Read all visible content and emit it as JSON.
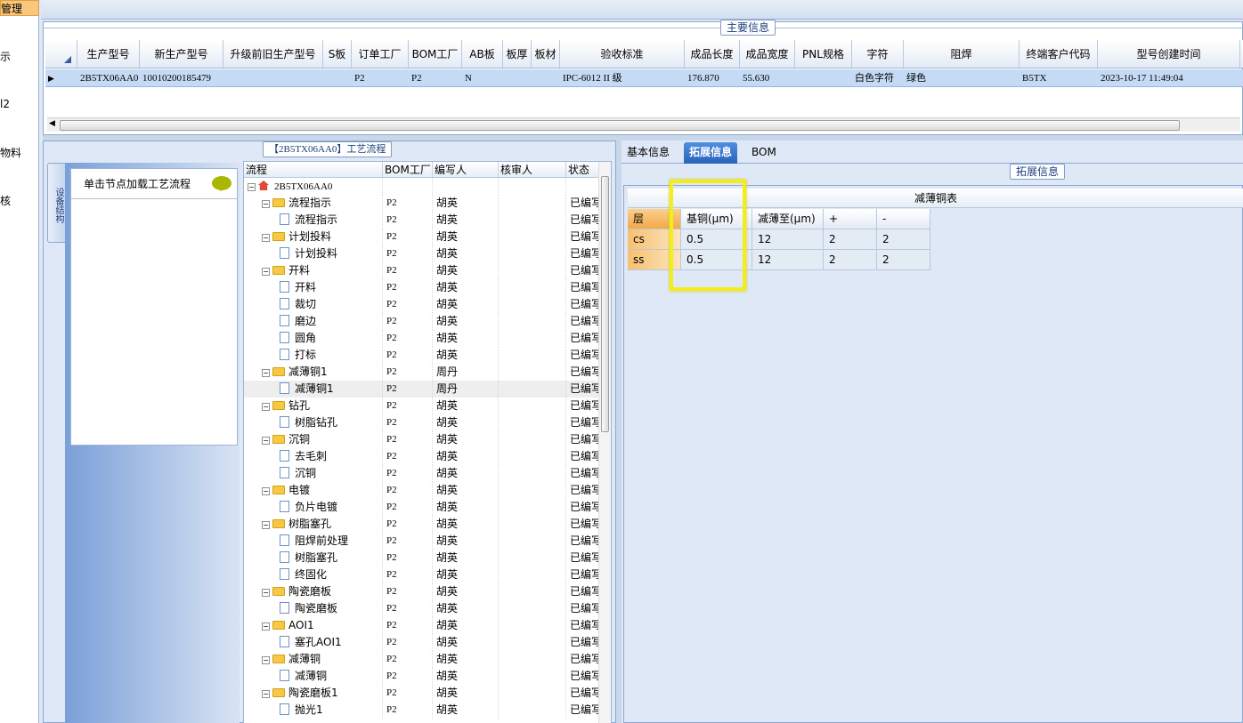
{
  "left_nav": {
    "items": [
      {
        "label": "管理",
        "active": true
      },
      {
        "label": "示"
      },
      {
        "label": "l2"
      },
      {
        "label": "物料"
      },
      {
        "label": "核"
      }
    ]
  },
  "top_strip": {
    "text": "·······"
  },
  "main_info": {
    "title": "主要信息",
    "columns": [
      "生产型号",
      "新生产型号",
      "升级前旧生产型号",
      "S板",
      "订单工厂",
      "BOM工厂",
      "AB板",
      "板厚",
      "板材",
      "验收标准",
      "成品长度",
      "成品宽度",
      "PNL规格",
      "字符",
      "阻焊",
      "终端客户代码",
      "型号创建时间"
    ],
    "row": [
      "2B5TX06AA0",
      "10010200185479",
      "",
      "",
      "P2",
      "P2",
      "N",
      "",
      "",
      "IPC-6012 II 级",
      "176.870",
      "55.630",
      "",
      "白色字符",
      "绿色",
      "B5TX",
      "2023-10-17 11:49:04"
    ]
  },
  "flow_panel": {
    "title": "【2B5TX06AA0】工艺流程",
    "vertical_tab": "设备结构",
    "hint": "单击节点加载工艺流程",
    "tree_columns": [
      "流程",
      "BOM工厂",
      "编写人",
      "核审人",
      "状态"
    ],
    "rows": [
      {
        "level": 0,
        "type": "root",
        "name": "2B5TX06AA0",
        "bom": "",
        "author": "",
        "reviewer": "",
        "status": ""
      },
      {
        "level": 1,
        "type": "folder",
        "name": "流程指示",
        "bom": "P2",
        "author": "胡英",
        "reviewer": "",
        "status": "已编写"
      },
      {
        "level": 2,
        "type": "file",
        "name": "流程指示",
        "bom": "P2",
        "author": "胡英",
        "reviewer": "",
        "status": "已编写"
      },
      {
        "level": 1,
        "type": "folder",
        "name": "计划投料",
        "bom": "P2",
        "author": "胡英",
        "reviewer": "",
        "status": "已编写"
      },
      {
        "level": 2,
        "type": "file",
        "name": "计划投料",
        "bom": "P2",
        "author": "胡英",
        "reviewer": "",
        "status": "已编写"
      },
      {
        "level": 1,
        "type": "folder",
        "name": "开料",
        "bom": "P2",
        "author": "胡英",
        "reviewer": "",
        "status": "已编写"
      },
      {
        "level": 2,
        "type": "file",
        "name": "开料",
        "bom": "P2",
        "author": "胡英",
        "reviewer": "",
        "status": "已编写"
      },
      {
        "level": 2,
        "type": "file",
        "name": "裁切",
        "bom": "P2",
        "author": "胡英",
        "reviewer": "",
        "status": "已编写"
      },
      {
        "level": 2,
        "type": "file",
        "name": "磨边",
        "bom": "P2",
        "author": "胡英",
        "reviewer": "",
        "status": "已编写"
      },
      {
        "level": 2,
        "type": "file",
        "name": "圆角",
        "bom": "P2",
        "author": "胡英",
        "reviewer": "",
        "status": "已编写"
      },
      {
        "level": 2,
        "type": "file",
        "name": "打标",
        "bom": "P2",
        "author": "胡英",
        "reviewer": "",
        "status": "已编写"
      },
      {
        "level": 1,
        "type": "folder",
        "name": "减薄铜1",
        "bom": "P2",
        "author": "周丹",
        "reviewer": "",
        "status": "已编写"
      },
      {
        "level": 2,
        "type": "file",
        "name": "减薄铜1",
        "bom": "P2",
        "author": "周丹",
        "reviewer": "",
        "status": "已编写",
        "selected": true
      },
      {
        "level": 1,
        "type": "folder",
        "name": "钻孔",
        "bom": "P2",
        "author": "胡英",
        "reviewer": "",
        "status": "已编写"
      },
      {
        "level": 2,
        "type": "file",
        "name": "树脂钻孔",
        "bom": "P2",
        "author": "胡英",
        "reviewer": "",
        "status": "已编写"
      },
      {
        "level": 1,
        "type": "folder",
        "name": "沉铜",
        "bom": "P2",
        "author": "胡英",
        "reviewer": "",
        "status": "已编写"
      },
      {
        "level": 2,
        "type": "file",
        "name": "去毛刺",
        "bom": "P2",
        "author": "胡英",
        "reviewer": "",
        "status": "已编写"
      },
      {
        "level": 2,
        "type": "file",
        "name": "沉铜",
        "bom": "P2",
        "author": "胡英",
        "reviewer": "",
        "status": "已编写"
      },
      {
        "level": 1,
        "type": "folder",
        "name": "电镀",
        "bom": "P2",
        "author": "胡英",
        "reviewer": "",
        "status": "已编写"
      },
      {
        "level": 2,
        "type": "file",
        "name": "负片电镀",
        "bom": "P2",
        "author": "胡英",
        "reviewer": "",
        "status": "已编写"
      },
      {
        "level": 1,
        "type": "folder",
        "name": "树脂塞孔",
        "bom": "P2",
        "author": "胡英",
        "reviewer": "",
        "status": "已编写"
      },
      {
        "level": 2,
        "type": "file",
        "name": "阻焊前处理",
        "bom": "P2",
        "author": "胡英",
        "reviewer": "",
        "status": "已编写"
      },
      {
        "level": 2,
        "type": "file",
        "name": "树脂塞孔",
        "bom": "P2",
        "author": "胡英",
        "reviewer": "",
        "status": "已编写"
      },
      {
        "level": 2,
        "type": "file",
        "name": "终固化",
        "bom": "P2",
        "author": "胡英",
        "reviewer": "",
        "status": "已编写"
      },
      {
        "level": 1,
        "type": "folder",
        "name": "陶瓷磨板",
        "bom": "P2",
        "author": "胡英",
        "reviewer": "",
        "status": "已编写"
      },
      {
        "level": 2,
        "type": "file",
        "name": "陶瓷磨板",
        "bom": "P2",
        "author": "胡英",
        "reviewer": "",
        "status": "已编写"
      },
      {
        "level": 1,
        "type": "folder",
        "name": "AOI1",
        "bom": "P2",
        "author": "胡英",
        "reviewer": "",
        "status": "已编写"
      },
      {
        "level": 2,
        "type": "file",
        "name": "塞孔AOI1",
        "bom": "P2",
        "author": "胡英",
        "reviewer": "",
        "status": "已编写"
      },
      {
        "level": 1,
        "type": "folder",
        "name": "减薄铜",
        "bom": "P2",
        "author": "胡英",
        "reviewer": "",
        "status": "已编写"
      },
      {
        "level": 2,
        "type": "file",
        "name": "减薄铜",
        "bom": "P2",
        "author": "胡英",
        "reviewer": "",
        "status": "已编写"
      },
      {
        "level": 1,
        "type": "folder",
        "name": "陶瓷磨板1",
        "bom": "P2",
        "author": "胡英",
        "reviewer": "",
        "status": "已编写"
      },
      {
        "level": 2,
        "type": "file",
        "name": "抛光1",
        "bom": "P2",
        "author": "胡英",
        "reviewer": "",
        "status": "已编写"
      }
    ]
  },
  "right_panel": {
    "tabs": [
      {
        "label": "基本信息",
        "active": false
      },
      {
        "label": "拓展信息",
        "active": true
      },
      {
        "label": "BOM",
        "active": false
      }
    ],
    "group_title": "拓展信息",
    "table_title": "减薄铜表",
    "table_columns": [
      "层",
      "基铜(μm)",
      "减薄至(μm)",
      "+",
      "-"
    ],
    "table_rows": [
      [
        "cs",
        "0.5",
        "12",
        "2",
        "2"
      ],
      [
        "ss",
        "0.5",
        "12",
        "2",
        "2"
      ]
    ]
  },
  "colors": {
    "highlight": "#f2ee1e",
    "selected_row": "#c5dbf5",
    "active_tab": "#2a63b8",
    "panel_bg": "#dfe8f6"
  }
}
